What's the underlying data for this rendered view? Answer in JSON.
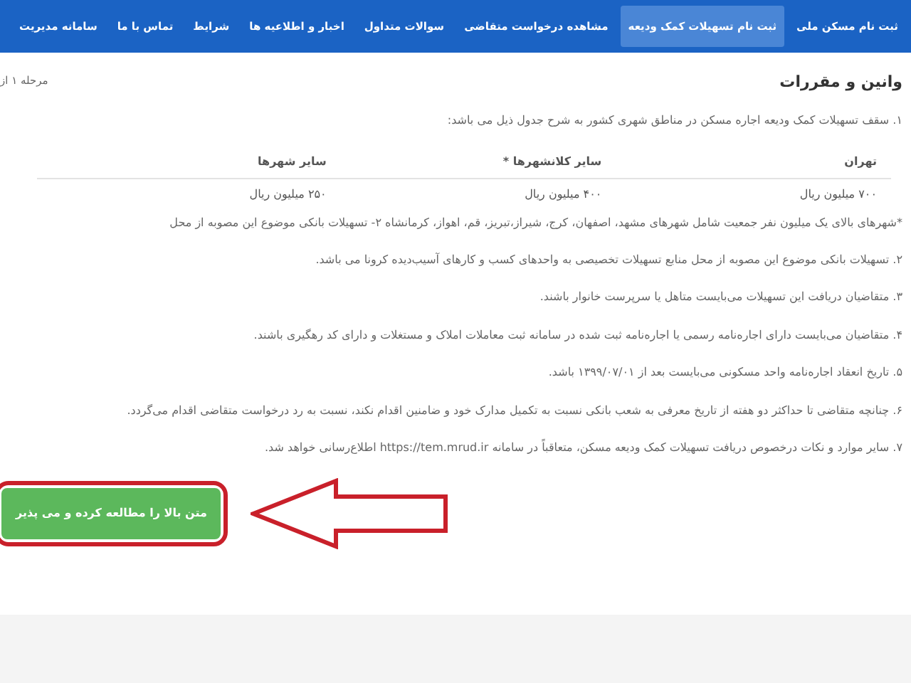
{
  "nav": [
    {
      "label": "ثبت نام مسکن ملی",
      "selected": false
    },
    {
      "label": "ثبت نام تسهیلات کمک ودیعه",
      "selected": true
    },
    {
      "label": "مشاهده درخواست متقاضی",
      "selected": false
    },
    {
      "label": "سوالات متداول",
      "selected": false
    },
    {
      "label": "اخبار و اطلاعیه ها",
      "selected": false
    },
    {
      "label": "شرایط",
      "selected": false
    },
    {
      "label": "تماس با ما",
      "selected": false
    },
    {
      "label": "سامانه مدیریت",
      "selected": false
    }
  ],
  "title": "وانین و مقررات",
  "step": "مرحله ۱ از",
  "rules_intro": {
    "number": "۱.",
    "text": "سقف تسهیلات کمک ودیعه اجاره مسکن در مناطق شهری کشور به شرح جدول ذیل می باشد:"
  },
  "table": {
    "columns": [
      "تهران",
      "سایر کلانشهرها *",
      "سایر شهرها"
    ],
    "rows": [
      [
        "۷۰۰ میلیون ریال",
        "۴۰۰ میلیون ریال",
        "۲۵۰ میلیون ریال"
      ]
    ]
  },
  "footnote": "*شهرهای بالای یک میلیون نفر جمعیت شامل شهرهای مشهد، اصفهان، کرج، شیراز،تبریز، قم، اهواز، کرمانشاه ۲- تسهیلات بانکی موضوع این مصوبه از محل",
  "rules": [
    {
      "number": "۲.",
      "text": "تسهیلات بانکی موضوع این مصوبه از محل منابع تسهیلات تخصیصی به واحدهای کسب و کارهای آسیب‌دیده کرونا می باشد."
    },
    {
      "number": "۳.",
      "text": "متقاضیان دریافت این تسهیلات می‌بایست متاهل یا سرپرست خانوار باشند."
    },
    {
      "number": "۴.",
      "text": "متقاضیان می‌بایست دارای اجاره‌نامه رسمی یا اجاره‌نامه ثبت شده در سامانه ثبت معاملات املاک و مستغلات و دارای کد رهگیری باشند."
    },
    {
      "number": "۵.",
      "text": "تاریخ انعقاد اجاره‌نامه واحد مسکونی می‌بایست بعد از ۱۳۹۹/۰۷/۰۱ باشد."
    },
    {
      "number": "۶.",
      "text": "چنانچه متقاضی تا حداکثر دو هفته از تاریخ معرفی به شعب بانکی نسبت به تکمیل مدارک خود و ضامنین اقدام نکند، نسبت به رد درخواست متقاضی اقدام می‌گردد."
    },
    {
      "number": "۷.",
      "text": "سایر موارد و نکات درخصوص دریافت تسهیلات کمک ودیعه مسکن، متعاقباً در سامانه https://tem.mrud.ir اطلاع‌رسانی خواهد شد."
    }
  ],
  "accept_button": "متن بالا را مطالعه کرده و می پذیر"
}
